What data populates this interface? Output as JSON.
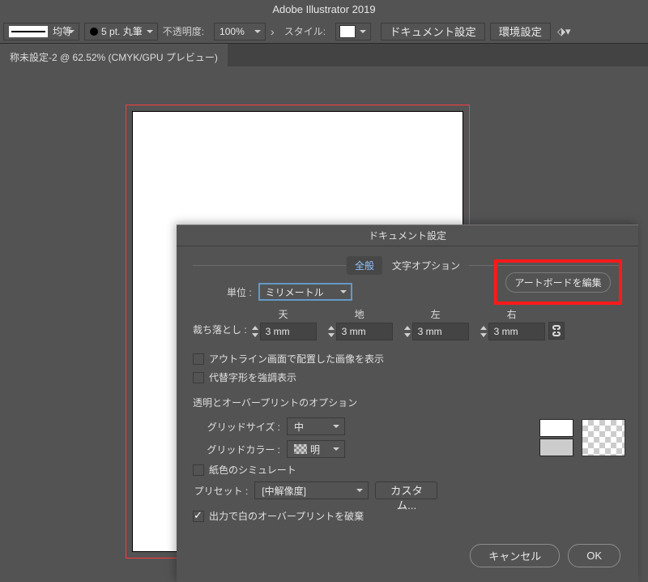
{
  "app_title": "Adobe Illustrator 2019",
  "control_bar": {
    "uniform": "均等",
    "stroke": "5 pt. 丸筆",
    "opacity_label": "不透明度:",
    "opacity_value": "100%",
    "style_label": "スタイル:",
    "doc_setup_btn": "ドキュメント設定",
    "preferences_btn": "環境設定"
  },
  "document_tab": "称未設定-2 @ 62.52% (CMYK/GPU プレビュー)",
  "dialog": {
    "title": "ドキュメント設定",
    "tabs": {
      "general": "全般",
      "text_options": "文字オプション"
    },
    "unit_label": "単位 :",
    "unit_value": "ミリメートル",
    "edit_artboards": "アートボードを編集",
    "bleed_label": "裁ち落とし :",
    "bleed": {
      "top_label": "天",
      "top_value": "3 mm",
      "bottom_label": "地",
      "bottom_value": "3 mm",
      "left_label": "左",
      "left_value": "3 mm",
      "right_label": "右",
      "right_value": "3 mm"
    },
    "chk_outline_images": "アウトライン画面で配置した画像を表示",
    "chk_alt_glyphs": "代替字形を強調表示",
    "section_transparency": "透明とオーバープリントのオプション",
    "grid_size_label": "グリッドサイズ :",
    "grid_size_value": "中",
    "grid_color_label": "グリッドカラー :",
    "grid_color_value": "明",
    "chk_paper_simulate": "紙色のシミュレート",
    "preset_label": "プリセット :",
    "preset_value": "[中解像度]",
    "custom_btn": "カスタム...",
    "chk_discard_white_overprint": "出力で白のオーバープリントを破棄",
    "cancel": "キャンセル",
    "ok": "OK"
  }
}
